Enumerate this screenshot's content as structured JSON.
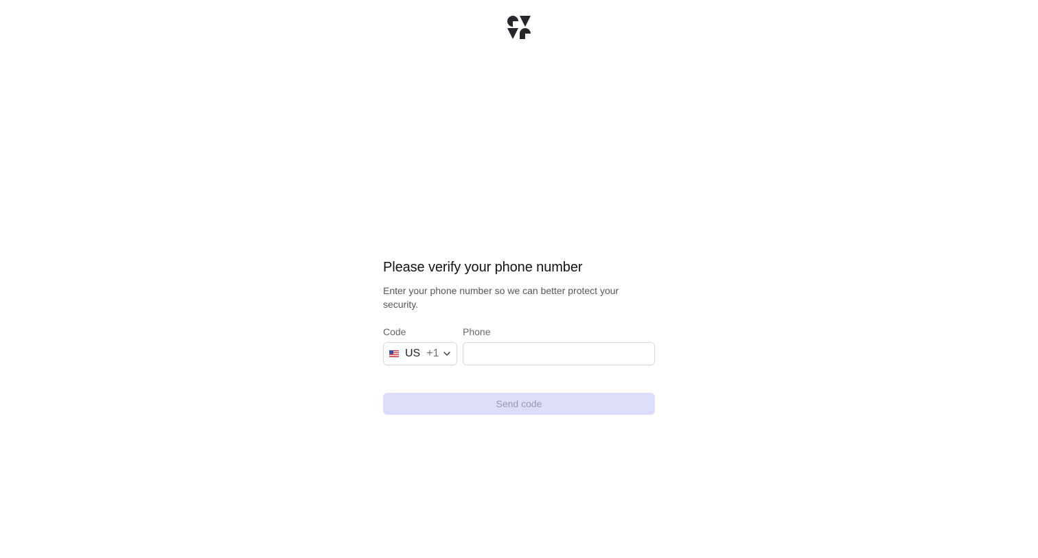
{
  "brand": {
    "logo_icon": "brand-logo-icon",
    "logo_color": "#26262b"
  },
  "form": {
    "title": "Please verify your phone number",
    "subtitle": "Enter your phone number so we can better protect your security.",
    "code_label": "Code",
    "phone_label": "Phone",
    "country": {
      "flag_icon": "us-flag-icon",
      "code": "US",
      "dial": "+1"
    },
    "phone_value": "",
    "phone_placeholder": "",
    "send_label": "Send code"
  },
  "colors": {
    "button_disabled_bg": "#dcdcfb",
    "button_disabled_text": "#9a9aae",
    "border": "#d6d6db"
  }
}
